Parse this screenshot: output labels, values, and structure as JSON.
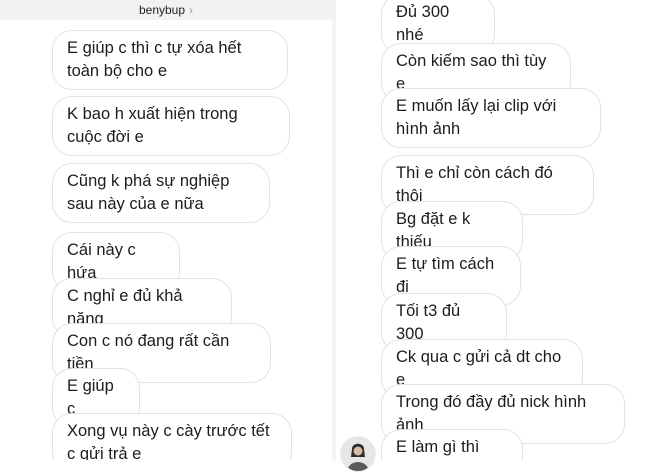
{
  "header": {
    "username": "benybup",
    "chevron_icon": "chevron-right-icon"
  },
  "left_messages": [
    "E giúp c thì c tự xóa hết toàn bộ cho e",
    "K bao h xuất hiện trong cuộc đời e",
    "Cũng k phá sự nghiệp sau này của e nữa",
    "Cái này c hứa",
    "C nghỉ e đủ khả năng",
    "Con c nó đang rất cần tiền",
    "E giúp c",
    "Xong vụ này c cày trước tết c gửi trả e"
  ],
  "right_messages": [
    "Đủ 300 nhé",
    "Còn kiếm sao thì tùy e",
    "E muốn lấy lại clip với hình ảnh",
    "Thì e chỉ còn cách đó thôi",
    "Bg đặt e k thiếu",
    "E tự tìm cách đi",
    "Tối t3 đủ 300",
    "Ck qua c gửi cả dt cho e",
    "Trong đó đầy đủ nick hình ảnh",
    "E làm gì thì làm"
  ],
  "avatar_icon": "profile-avatar"
}
